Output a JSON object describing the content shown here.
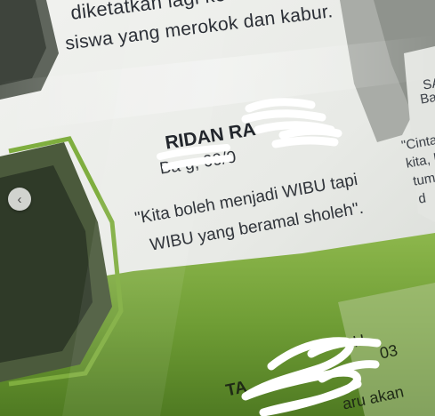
{
  "page_text": {
    "line_1": "diketatkan lagi  ke",
    "line_2": "siswa yang merokok dan kabur.",
    "student_name": "RIDAN RA",
    "birth_line": "Ba    g, 09/0",
    "quote_line_1": "\"Kita boleh menjadi WIBU tapi",
    "quote_line_2": "WIBU yang beramal sholeh\"."
  },
  "side_text": {
    "fragment_1": "SA",
    "fragment_2": "Bar",
    "fragment_3": "\"Cinta",
    "fragment_4": "kita, k",
    "fragment_5": "tumb",
    "fragment_6": "d"
  },
  "bottom_text": {
    "name_fragment": "TA",
    "year_fragment": "H",
    "year_digits": "03",
    "caption_fragment": "aru akan"
  },
  "controls": {
    "prev_arrow": "‹"
  },
  "colors": {
    "paper": "#e9ebe7",
    "green": "#7aa640",
    "scribble": "#ffffff",
    "text": "#2b2f36"
  }
}
